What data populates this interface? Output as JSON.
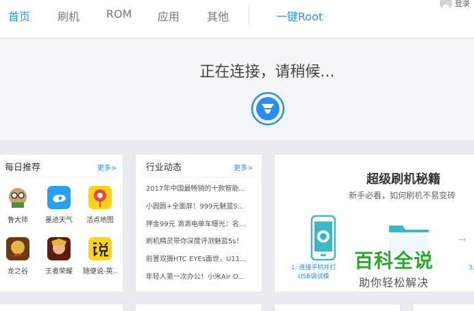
{
  "nav": {
    "tabs": [
      "首页",
      "刷机",
      "ROM",
      "应用",
      "其他"
    ],
    "root_label": "一键Root",
    "login_label": "登录"
  },
  "connect": {
    "status_text": "正在连接，请稍候..."
  },
  "daily": {
    "title": "每日推荐",
    "more": "更多>",
    "apps": [
      {
        "label": "鲁大师",
        "icon": "ludashi-icon"
      },
      {
        "label": "墨迹天气",
        "icon": "moji-weather-icon"
      },
      {
        "label": "活点地图",
        "icon": "huodian-map-icon"
      },
      {
        "label": "龙之谷",
        "icon": "dragon-nest-icon"
      },
      {
        "label": "王者荣耀",
        "icon": "honor-of-kings-icon"
      },
      {
        "label": "随便说-英...",
        "icon": "suibianshuo-icon"
      }
    ]
  },
  "industry": {
    "title": "行业动态",
    "more": "更多>",
    "items": [
      "2017年中国最畅销的十款智能...",
      "小圆圆+全面屏！999元魅蓝S...",
      "押金99元 滴滴电单车曝光：名...",
      "刷机精灵带你深度评测魅蓝5s！",
      "前置双摄HTC EYEs面世，U11...",
      "年轻人第一次办公！小米Air O..."
    ]
  },
  "guide": {
    "title": "超级刷机秘籍",
    "subtitle": "新手必看，如何刷机不易变砖",
    "step1_line1": "1. 连接手机并打",
    "step1_line2": "USB调试模",
    "step3": "3."
  },
  "watermark": {
    "big": "百科全说",
    "small": "助你轻松解决"
  },
  "colors": {
    "accent": "#2a8ef0",
    "watermark_green": "#2ea52e"
  }
}
